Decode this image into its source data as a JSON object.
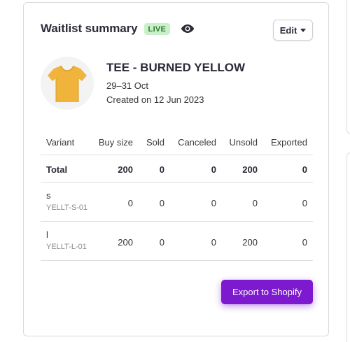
{
  "card": {
    "title": "Waitlist summary",
    "status_badge": "LIVE",
    "edit_label": "Edit"
  },
  "product": {
    "name": "TEE - BURNED YELLOW",
    "dates": "29–31 Oct",
    "created": "Created on 12 Jun 2023",
    "image_color": "#f0b43c"
  },
  "table": {
    "columns": {
      "variant": "Variant",
      "buy_size": "Buy size",
      "sold": "Sold",
      "canceled": "Canceled",
      "unsold": "Unsold",
      "exported": "Exported"
    },
    "total": {
      "label": "Total",
      "buy_size": "200",
      "sold": "0",
      "canceled": "0",
      "unsold": "200",
      "exported": "0"
    },
    "rows": [
      {
        "name": "s",
        "sku": "YELLT-S-01",
        "buy_size": "0",
        "sold": "0",
        "canceled": "0",
        "unsold": "0",
        "exported": "0"
      },
      {
        "name": "l",
        "sku": "YELLT-L-01",
        "buy_size": "200",
        "sold": "0",
        "canceled": "0",
        "unsold": "200",
        "exported": "0"
      }
    ]
  },
  "actions": {
    "export_label": "Export to Shopify"
  },
  "colors": {
    "accent": "#7d19cf",
    "live_bg": "#c9f0c9",
    "live_text": "#2e7a2e"
  },
  "icons": {
    "visibility": "eye-icon",
    "dropdown": "caret-down-icon",
    "product": "t-shirt-image"
  }
}
